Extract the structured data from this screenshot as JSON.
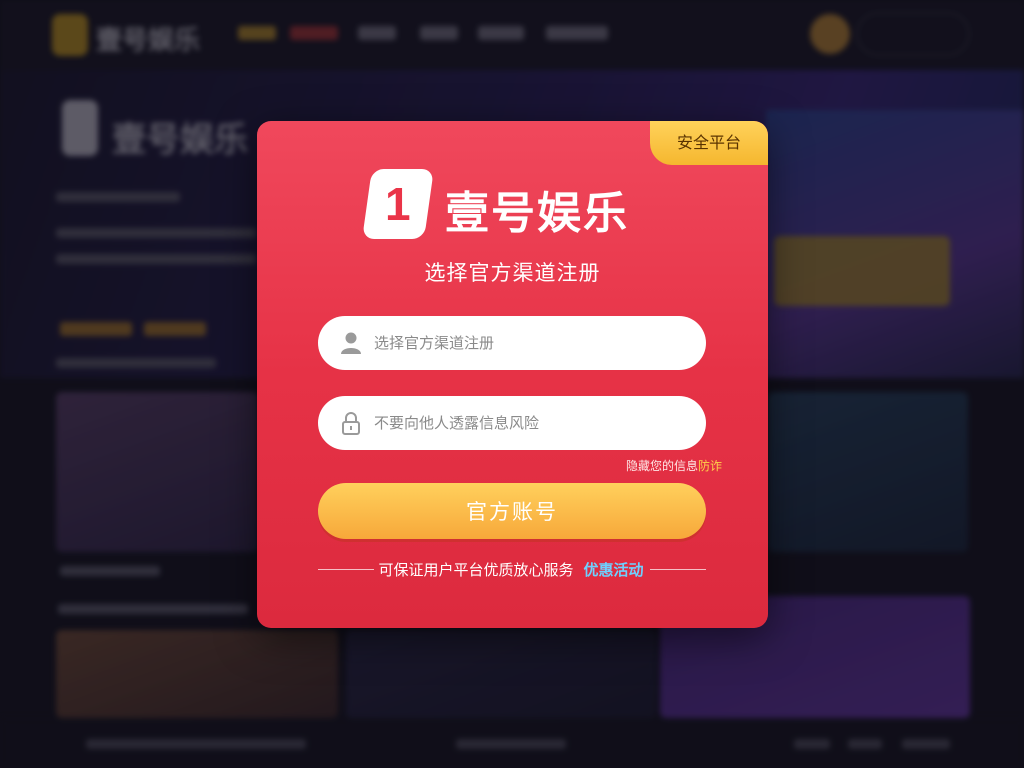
{
  "background_site": {
    "logo_text": "壹号娱乐",
    "hero_logo_text": "壹号娱乐"
  },
  "modal": {
    "badge": "安全平台",
    "brand": {
      "mark": "1",
      "name": "壹号娱乐"
    },
    "subtitle": "选择官方渠道注册",
    "username": {
      "placeholder": "选择官方渠道注册"
    },
    "password": {
      "placeholder": "不要向他人透露信息风险"
    },
    "hint_text": "隐藏您的信息",
    "hint_highlight": "防诈",
    "submit_label": "官方账号",
    "footer_text": "可保证用户平台优质放心服务",
    "footer_link": "优惠活动"
  },
  "colors": {
    "modal_red": "#e63246",
    "badge_yellow": "#f5b72f",
    "button_orange": "#f7a83a",
    "link_blue": "#6fd0ff"
  },
  "icons": {
    "user": "user-icon",
    "lock": "lock-icon"
  }
}
